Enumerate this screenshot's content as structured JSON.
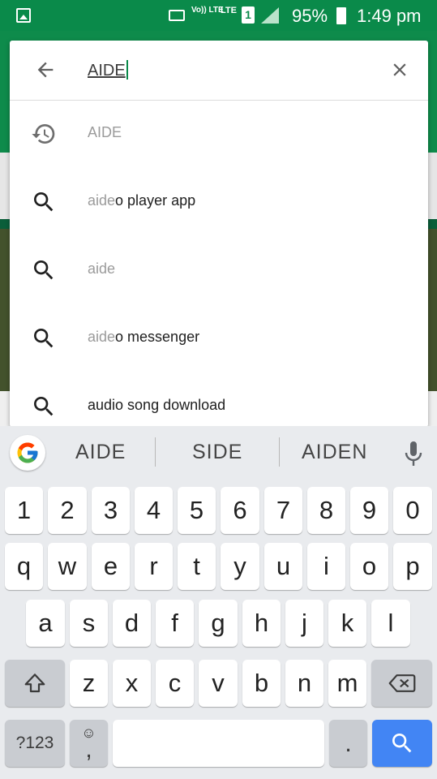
{
  "status_bar": {
    "volte_label": "Vo)) LTE",
    "lte_label": "LTE",
    "sim_label": "1",
    "battery_percent": "95%",
    "time": "1:49 pm"
  },
  "search": {
    "query": "AIDE",
    "suggestions": [
      {
        "type": "history",
        "match": "",
        "rest": "AIDE"
      },
      {
        "type": "search",
        "match": "aide",
        "rest": "o player app"
      },
      {
        "type": "search",
        "match": "aide",
        "rest": ""
      },
      {
        "type": "search",
        "match": "aide",
        "rest": "o messenger"
      },
      {
        "type": "search",
        "match": "",
        "rest": "audio song download"
      }
    ]
  },
  "keyboard": {
    "suggestions": [
      "AIDE",
      "SIDE",
      "AIDEN"
    ],
    "number_row": [
      "1",
      "2",
      "3",
      "4",
      "5",
      "6",
      "7",
      "8",
      "9",
      "0"
    ],
    "row1": [
      "q",
      "w",
      "e",
      "r",
      "t",
      "y",
      "u",
      "i",
      "o",
      "p"
    ],
    "row2": [
      "a",
      "s",
      "d",
      "f",
      "g",
      "h",
      "j",
      "k",
      "l"
    ],
    "row3": [
      "z",
      "x",
      "c",
      "v",
      "b",
      "n",
      "m"
    ],
    "symbols_label": "?123",
    "comma_label": ",",
    "emoji_label": "☺",
    "period_label": "."
  },
  "colors": {
    "status_bar": "#0a8a4a",
    "search_key": "#4285f4",
    "caret": "#0a8a4a"
  }
}
